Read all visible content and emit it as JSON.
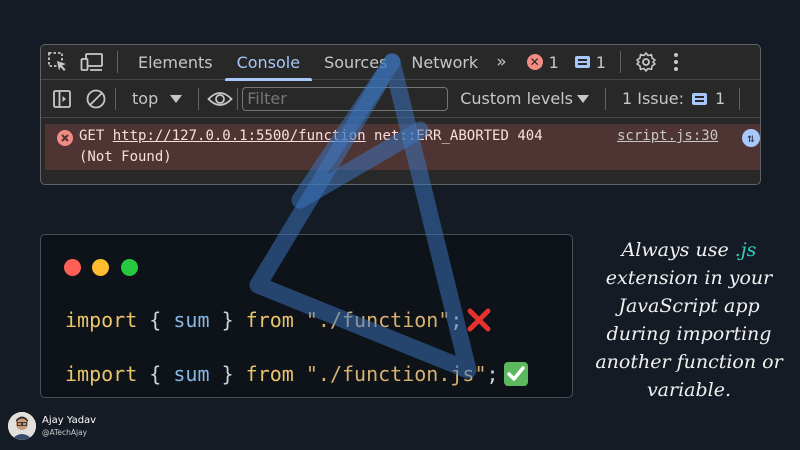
{
  "devtools": {
    "tabs": [
      "Elements",
      "Console",
      "Sources",
      "Network"
    ],
    "active_tab": "Console",
    "more_tabs": "»",
    "error_count": "1",
    "message_count": "1",
    "toolbar": {
      "context": "top",
      "filter_placeholder": "Filter",
      "levels": "Custom levels",
      "issues_label": "1 Issue:",
      "issues_count": "1"
    },
    "error": {
      "method": "GET",
      "url": "http://127.0.0.1:5500/function",
      "message": "net::ERR_ABORTED 404",
      "status": "(Not Found)",
      "source": "script.js:30"
    }
  },
  "code": {
    "line1": {
      "keyword": "import",
      "open": "{",
      "name": "sum",
      "close": "}",
      "from": "from",
      "path": "\"./function\"",
      "semicolon": ";",
      "mark": "cross-mark"
    },
    "line2": {
      "keyword": "import",
      "open": "{",
      "name": "sum",
      "close": "}",
      "from": "from",
      "path": "\"./function.js\"",
      "semicolon": ";",
      "mark": "check-mark"
    },
    "window_dots": [
      "#ff5f57",
      "#febc2e",
      "#28c840"
    ]
  },
  "tip": {
    "before": "Always use ",
    "highlight": ".js",
    "after": " extension in your JavaScript app during importing another function or variable."
  },
  "author": {
    "name": "Ajay Yadav",
    "handle": "@ATechAjay"
  },
  "colors": {
    "background": "#141b24",
    "panel": "#282828",
    "accent": "#a8c7fa",
    "error_row": "#4e3534",
    "tip_highlight": "#2dd4bf"
  }
}
